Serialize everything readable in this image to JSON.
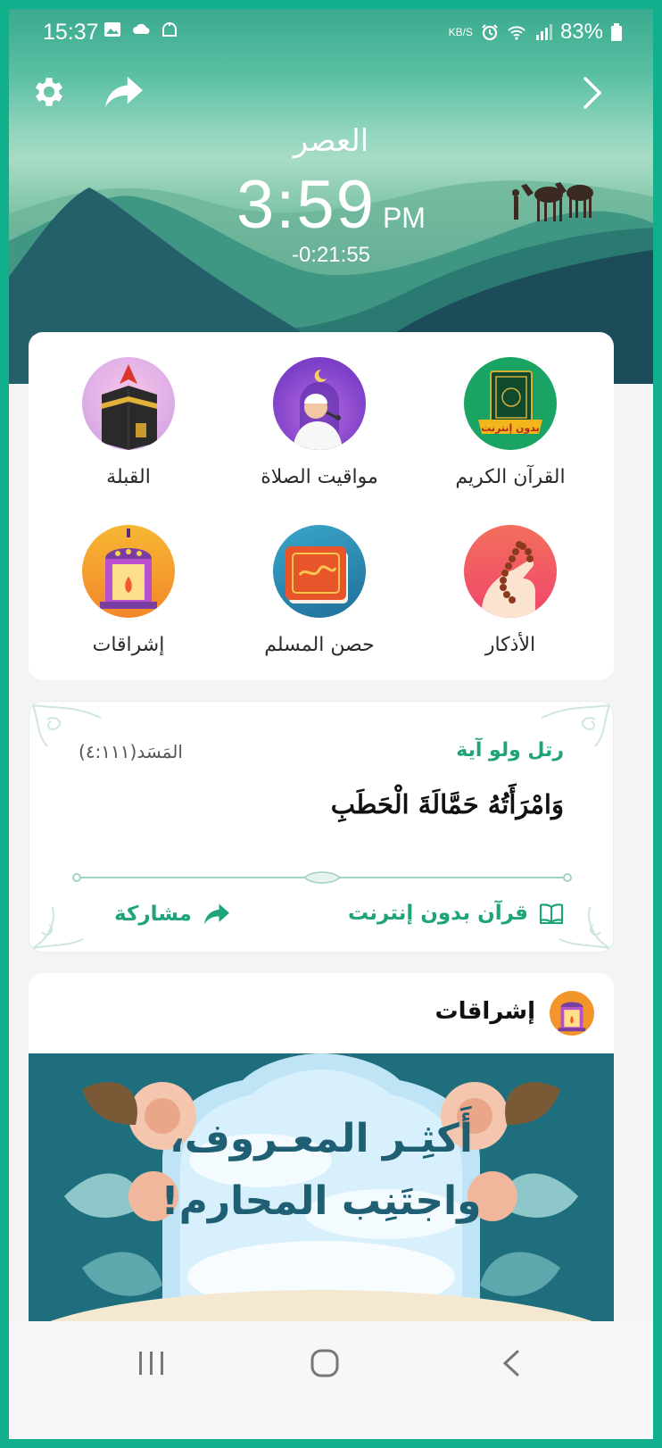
{
  "status_bar": {
    "time": "15:37",
    "battery": "83%",
    "data_label": "KB/S"
  },
  "header": {
    "prayer_name": "العصر",
    "prayer_time": "3:59",
    "ampm": "PM",
    "countdown": "-0:21:55"
  },
  "grid": {
    "items": [
      {
        "label": "القرآن الكريم",
        "badge": "بدون إنترنت"
      },
      {
        "label": "مواقيت الصلاة"
      },
      {
        "label": "القبلة"
      },
      {
        "label": "الأذكار"
      },
      {
        "label": "حصن المسلم"
      },
      {
        "label": "إشراقات"
      }
    ]
  },
  "verse": {
    "title": "رتل ولو آية",
    "reference": "المَسَد(٤:١١١)",
    "text": "وَامْرَأَتُهُ حَمَّالَةَ الْحَطَبِ",
    "quran_offline": "قرآن بدون إنترنت",
    "share": "مشاركة"
  },
  "ishraqat": {
    "title": "إشراقات",
    "line1": "أَكثِـر المعـروف،",
    "line2": "واجتَنِب المحارم!"
  },
  "colors": {
    "accent": "#1ea37a",
    "frame": "#10b08c"
  }
}
